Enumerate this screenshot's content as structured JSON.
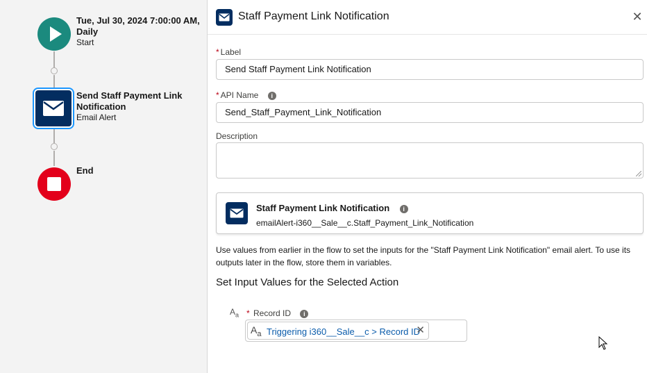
{
  "canvas": {
    "start": {
      "title_line1": "Tue, Jul 30, 2024 7:00:00 AM,",
      "title_line2": "Daily",
      "subtitle": "Start"
    },
    "action": {
      "title_line1": "Send Staff Payment Link",
      "title_line2": "Notification",
      "subtitle": "Email Alert"
    },
    "end": {
      "title": "End"
    }
  },
  "panel": {
    "title": "Staff Payment Link Notification",
    "close_icon": "close-icon",
    "label": {
      "label": "Label",
      "required_marker": "*",
      "value": "Send Staff Payment Link Notification"
    },
    "api_name": {
      "label": "API Name",
      "required_marker": "*",
      "info_glyph": "i",
      "value": "Send_Staff_Payment_Link_Notification"
    },
    "description": {
      "label": "Description",
      "value": ""
    },
    "action_card": {
      "title": "Staff Payment Link Notification",
      "info_glyph": "i",
      "api": "emailAlert-i360__Sale__c.Staff_Payment_Link_Notification"
    },
    "help_text": "Use values from earlier in the flow to set the inputs for the \"Staff Payment Link Notification\" email alert. To use its outputs later in the flow, store them in variables.",
    "section_title": "Set Input Values for the Selected Action",
    "record_id": {
      "label": "Record ID",
      "required_marker": "*",
      "info_glyph": "i",
      "type_glyph": "A",
      "type_glyph_sub": "a",
      "pill_label": "Triggering i360__Sale__c > Record ID",
      "remove_glyph": "✕"
    }
  },
  "colors": {
    "start": "#1b8a7e",
    "action": "#032d60",
    "end": "#e3001b",
    "link": "#0b5cab",
    "required": "#ba0517"
  }
}
